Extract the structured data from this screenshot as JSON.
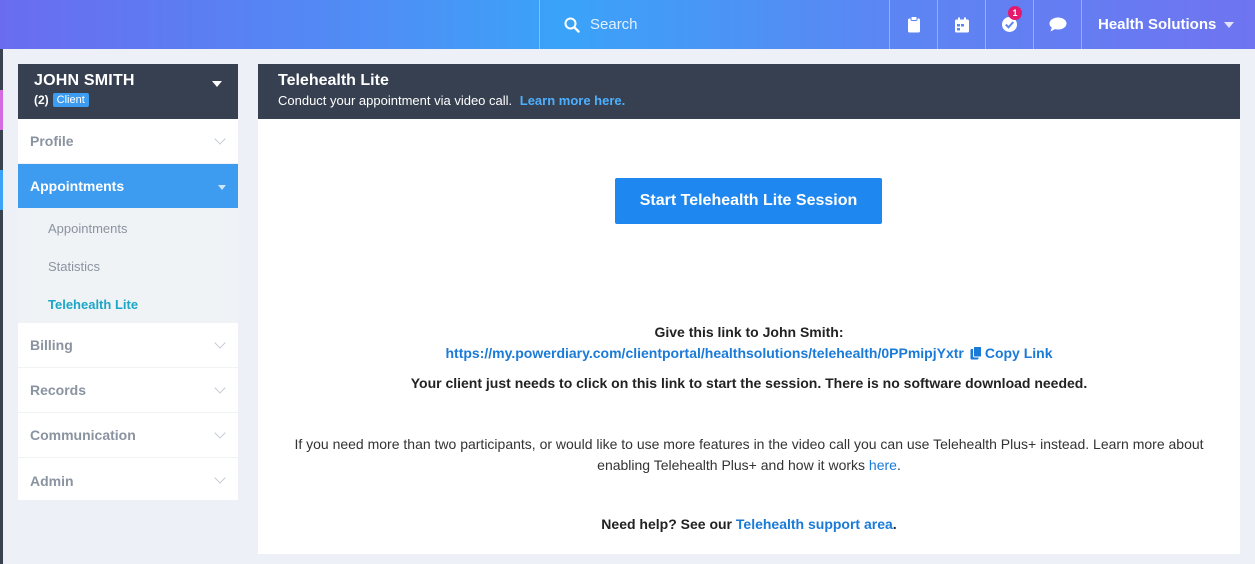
{
  "topbar": {
    "search_placeholder": "Search",
    "notification_count": "1",
    "practice_name": "Health Solutions"
  },
  "client": {
    "name": "JOHN SMITH",
    "count": "(2)",
    "tag": "Client"
  },
  "sidebar": {
    "items": [
      {
        "label": "Profile"
      },
      {
        "label": "Appointments"
      },
      {
        "label": "Billing"
      },
      {
        "label": "Records"
      },
      {
        "label": "Communication"
      },
      {
        "label": "Admin"
      }
    ],
    "sub_items": [
      {
        "label": "Appointments"
      },
      {
        "label": "Statistics"
      },
      {
        "label": "Telehealth Lite"
      }
    ]
  },
  "main": {
    "title": "Telehealth Lite",
    "subtitle": "Conduct your appointment via video call.",
    "learn_more": "Learn more here.",
    "start_button": "Start Telehealth Lite Session",
    "give_link": "Give this link to John Smith:",
    "session_url": "https://my.powerdiary.com/clientportal/healthsolutions/telehealth/0PPmipjYxtr",
    "copy_link": "Copy Link",
    "client_note": "Your client just needs to click on this link to start the session. There is no software download needed.",
    "plus_text": "If you need more than two participants, or would like to use more features in the video call you can use Telehealth Plus+ instead. Learn more about enabling Telehealth Plus+ and how it works",
    "plus_link": "here",
    "plus_end": ".",
    "help_text": "Need help? See our",
    "help_link": "Telehealth support area",
    "help_end": "."
  },
  "colors": {
    "accent": "#3d9bf0",
    "button": "#1e87f0",
    "header_dark": "#374050",
    "link": "#1a7ad8",
    "active_sub": "#1ca6c7",
    "badge": "#e5196b"
  }
}
